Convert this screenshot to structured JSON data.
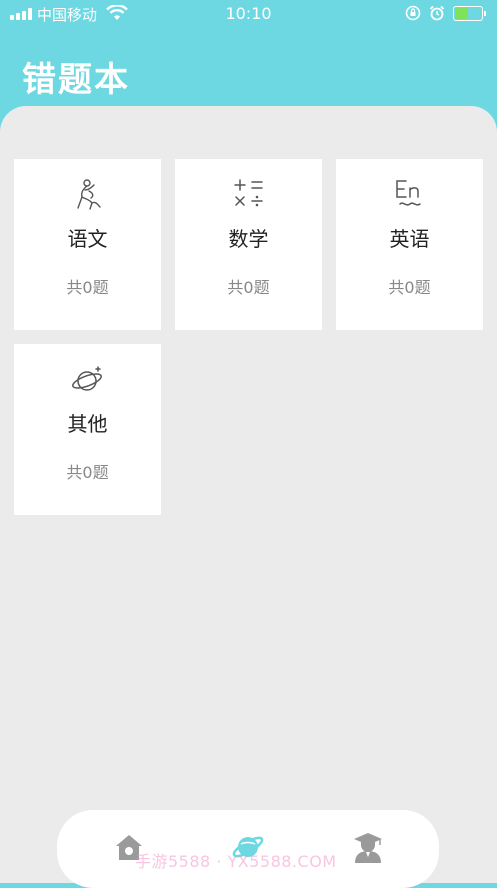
{
  "status_bar": {
    "carrier": "中国移动",
    "time": "10:10"
  },
  "header": {
    "title": "错题本"
  },
  "subjects": [
    {
      "name": "语文",
      "count": "共0题",
      "icon": "chinese-figure-icon"
    },
    {
      "name": "数学",
      "count": "共0题",
      "icon": "math-operators-icon"
    },
    {
      "name": "英语",
      "count": "共0题",
      "icon": "english-en-icon"
    },
    {
      "name": "其他",
      "count": "共0题",
      "icon": "planet-icon"
    }
  ],
  "tabbar": {
    "items": [
      {
        "icon": "home-icon",
        "active": false
      },
      {
        "icon": "planet-icon",
        "active": true
      },
      {
        "icon": "graduate-icon",
        "active": false
      }
    ]
  },
  "watermark": "手游5588 · YX5588.COM",
  "colors": {
    "header_bg": "#6dd8e2",
    "content_bg": "#ebebeb",
    "active_tab": "#6dd8e2",
    "inactive_tab": "#9a9a9a"
  }
}
